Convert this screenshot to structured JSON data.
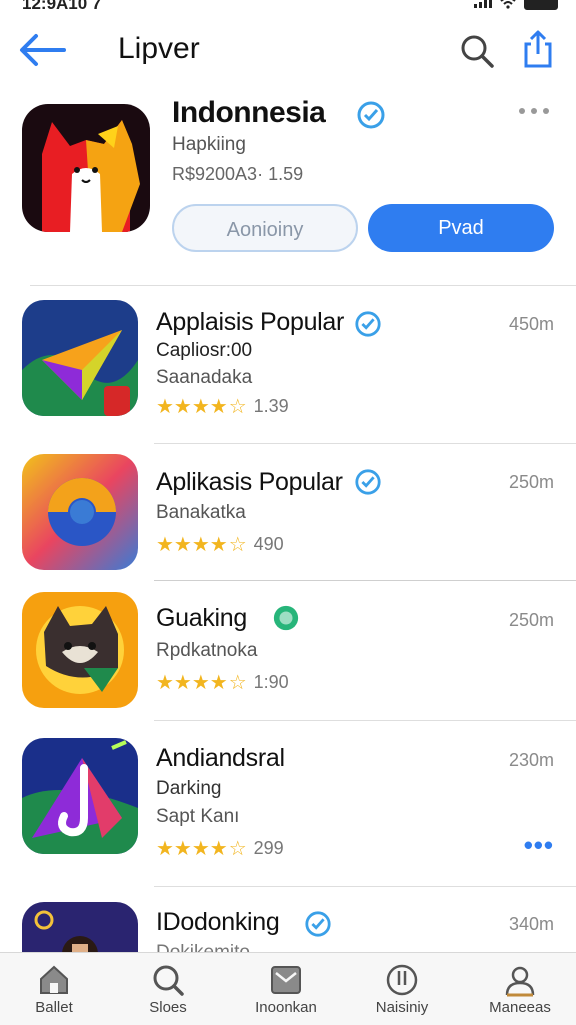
{
  "status": {
    "time": "12:9A10 7"
  },
  "nav": {
    "title": "Lipver"
  },
  "hero": {
    "name": "Indonnesia",
    "subtitle": "Hapkiing",
    "meta": "R$9200A3· 1.59",
    "button_outline": "Aonioiny",
    "button_primary": "Pvad"
  },
  "rows": [
    {
      "name": "Applaisis Popular",
      "line1": "Capliosr:00",
      "line2": "Saanadaka",
      "rating": "1.39",
      "size": "450m",
      "stars": 4.5,
      "badge_color": "#2f7df0"
    },
    {
      "name": "Aplikasis Popular",
      "line1": "Banakatka",
      "rating": "490",
      "size": "250m",
      "stars": 4.5,
      "badge_color": "#2f7df0"
    },
    {
      "name": "Guaking",
      "line1": "Rpdkatnoka",
      "rating": "1:90",
      "size": "250m",
      "stars": 4.5,
      "badge_color": "#27b57a"
    },
    {
      "name": "Andiandsral",
      "line1": "Darking",
      "line2": "Sapt Kanı",
      "rating": "299",
      "size": "230m",
      "stars": 4.5,
      "badge_color": "#2f7df0"
    },
    {
      "name": "IDodonking",
      "line1": "Dokikemito",
      "size": "340m",
      "badge_color": "#2f7df0"
    }
  ],
  "tabs": [
    {
      "label": "Ballet",
      "icon": "home-icon"
    },
    {
      "label": "Sloes",
      "icon": "search-icon"
    },
    {
      "label": "Inoonkan",
      "icon": "inbox-icon"
    },
    {
      "label": "Naisiniy",
      "icon": "clock-icon"
    },
    {
      "label": "Maneeas",
      "icon": "person-icon"
    }
  ],
  "colors": {
    "accent": "#2f7df0",
    "star": "#f2b51f",
    "verify_green": "#27b57a"
  }
}
